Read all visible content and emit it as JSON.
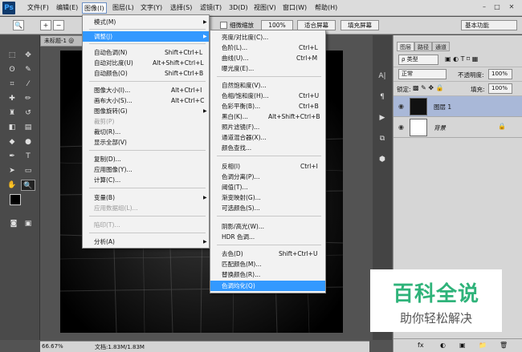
{
  "menubar": {
    "logo": "Ps",
    "items": [
      "文件(F)",
      "编辑(E)",
      "图像(I)",
      "图层(L)",
      "文字(Y)",
      "选择(S)",
      "滤镜(T)",
      "3D(D)",
      "视图(V)",
      "窗口(W)",
      "帮助(H)"
    ],
    "win_controls": [
      "–",
      "□",
      "✕"
    ]
  },
  "options": {
    "tool_glyph": "🔍",
    "check_label": "细微缩放",
    "zoom_value": "100%",
    "fit_btn": "适合屏幕",
    "fill_btn": "填充屏幕",
    "workspace": "基本功能"
  },
  "doc": {
    "tab": "未标题-1 @"
  },
  "status": {
    "zoom": "66.67%",
    "doc": "文档:1.83M/1.83M"
  },
  "image_menu": {
    "items": [
      {
        "label": "模式(M)",
        "shortcut": "",
        "arrow": true,
        "disabled": false
      },
      {
        "label": "调整(J)",
        "shortcut": "",
        "arrow": true,
        "disabled": false,
        "highlight": true
      },
      {
        "label": "自动色调(N)",
        "shortcut": "Shift+Ctrl+L"
      },
      {
        "label": "自动对比度(U)",
        "shortcut": "Alt+Shift+Ctrl+L"
      },
      {
        "label": "自动颜色(O)",
        "shortcut": "Shift+Ctrl+B"
      },
      {
        "label": "图像大小(I)...",
        "shortcut": "Alt+Ctrl+I"
      },
      {
        "label": "画布大小(S)...",
        "shortcut": "Alt+Ctrl+C"
      },
      {
        "label": "图像旋转(G)",
        "shortcut": "",
        "arrow": true
      },
      {
        "label": "裁剪(P)",
        "shortcut": "",
        "disabled": true
      },
      {
        "label": "裁切(R)...",
        "shortcut": ""
      },
      {
        "label": "显示全部(V)",
        "shortcut": ""
      },
      {
        "label": "复制(D)...",
        "shortcut": ""
      },
      {
        "label": "应用图像(Y)...",
        "shortcut": ""
      },
      {
        "label": "计算(C)...",
        "shortcut": ""
      },
      {
        "label": "变量(B)",
        "shortcut": "",
        "arrow": true
      },
      {
        "label": "应用数据组(L)...",
        "shortcut": "",
        "disabled": true
      },
      {
        "label": "陷印(T)...",
        "shortcut": "",
        "disabled": true
      },
      {
        "label": "分析(A)",
        "shortcut": "",
        "arrow": true
      }
    ]
  },
  "adjust_menu": {
    "items": [
      {
        "label": "亮度/对比度(C)...",
        "shortcut": ""
      },
      {
        "label": "色阶(L)...",
        "shortcut": "Ctrl+L"
      },
      {
        "label": "曲线(U)...",
        "shortcut": "Ctrl+M"
      },
      {
        "label": "曝光度(E)...",
        "shortcut": ""
      },
      {
        "label": "自然饱和度(V)...",
        "shortcut": ""
      },
      {
        "label": "色相/饱和度(H)...",
        "shortcut": "Ctrl+U"
      },
      {
        "label": "色彩平衡(B)...",
        "shortcut": "Ctrl+B"
      },
      {
        "label": "黑白(K)...",
        "shortcut": "Alt+Shift+Ctrl+B"
      },
      {
        "label": "照片滤镜(F)...",
        "shortcut": ""
      },
      {
        "label": "通道混合器(X)...",
        "shortcut": ""
      },
      {
        "label": "颜色查找...",
        "shortcut": ""
      },
      {
        "label": "反相(I)",
        "shortcut": "Ctrl+I"
      },
      {
        "label": "色调分离(P)...",
        "shortcut": ""
      },
      {
        "label": "阈值(T)...",
        "shortcut": ""
      },
      {
        "label": "渐变映射(G)...",
        "shortcut": ""
      },
      {
        "label": "可选颜色(S)...",
        "shortcut": ""
      },
      {
        "label": "阴影/高光(W)...",
        "shortcut": ""
      },
      {
        "label": "HDR 色调...",
        "shortcut": ""
      },
      {
        "label": "去色(D)",
        "shortcut": "Shift+Ctrl+U"
      },
      {
        "label": "匹配颜色(M)...",
        "shortcut": ""
      },
      {
        "label": "替换颜色(R)...",
        "shortcut": ""
      },
      {
        "label": "色调均化(Q)",
        "shortcut": "",
        "highlight": true
      }
    ]
  },
  "layers_panel": {
    "tabs": [
      "图层",
      "路径",
      "通道"
    ],
    "filter": "ρ 类型",
    "blend": "正常",
    "opacity_label": "不透明度:",
    "opacity": "100%",
    "lock_label": "锁定:",
    "fill_label": "填充:",
    "fill": "100%",
    "layers": [
      {
        "name": "图层 1",
        "selected": true
      },
      {
        "name": "背景",
        "italic": true,
        "locked": true
      }
    ],
    "bottom_icons": [
      "fx",
      "◐",
      "▣",
      "📁",
      "🗑"
    ]
  },
  "watermark": {
    "big": "百科全说",
    "small": "助你轻松解决"
  }
}
